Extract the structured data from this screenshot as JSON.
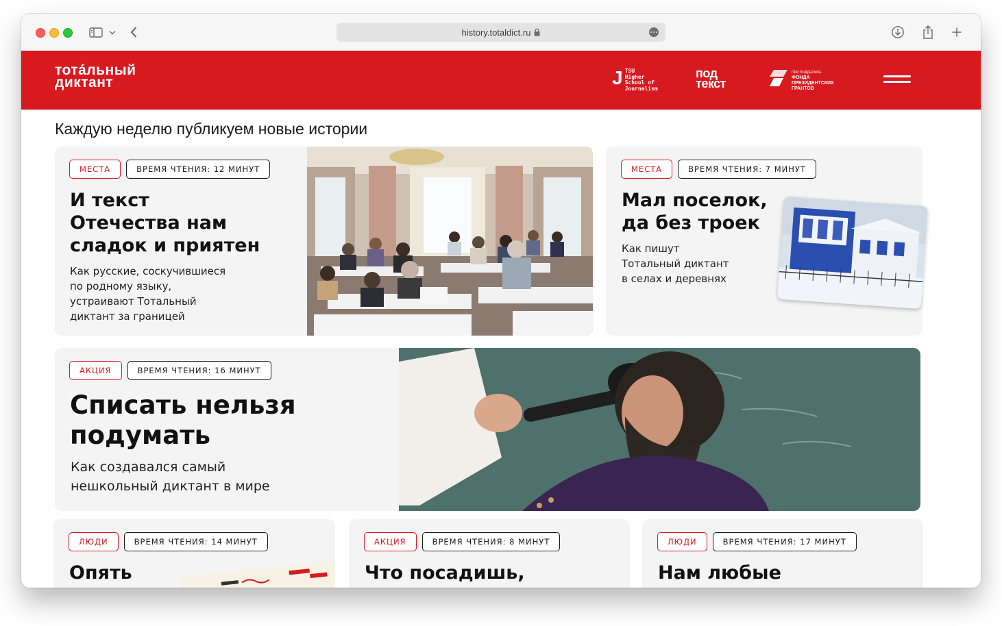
{
  "browser": {
    "url": "history.totaldict.ru"
  },
  "header": {
    "logo_line1": "тотáльный",
    "logo_line2": "диктант",
    "partners": {
      "tsu_line1": "TSU",
      "tsu_line2": "Higher",
      "tsu_line3": "School of",
      "tsu_line4": "Journalism",
      "podtekst_line1": "под",
      "podtekst_line2": "текст",
      "fond_line0": "ПРИ ПОДДЕРЖКЕ",
      "fond_line1": "ФОНДА",
      "fond_line2": "ПРЕЗИДЕНТСКИХ",
      "fond_line3": "ГРАНТОВ"
    }
  },
  "page": {
    "headline": "Каждую неделю публикуем новые истории"
  },
  "cards": [
    {
      "tag": "МЕСТА",
      "reading_time": "ВРЕМЯ ЧТЕНИЯ: 12 МИНУТ",
      "title_lines": [
        "И текст",
        "Отечества нам",
        "сладок и приятен"
      ],
      "desc_lines": [
        "Как русские, соскучившиеся",
        "по родному языку,",
        "устраивают Тотальный",
        "диктант за границей"
      ]
    },
    {
      "tag": "МЕСТА",
      "reading_time": "ВРЕМЯ ЧТЕНИЯ: 7 МИНУТ",
      "title_lines": [
        "Мал поселок,",
        "да без троек"
      ],
      "desc_lines": [
        "Как пишут",
        "Тотальный диктант",
        "в селах и деревнях"
      ]
    },
    {
      "tag": "АКЦИЯ",
      "reading_time": "ВРЕМЯ ЧТЕНИЯ: 16 МИНУТ",
      "title_lines": [
        "Списать нельзя",
        "подумать"
      ],
      "desc_lines": [
        "Как создавался самый",
        "нешкольный диктант в мире"
      ]
    },
    {
      "tag": "ЛЮДИ",
      "reading_time": "ВРЕМЯ ЧТЕНИЯ: 14 МИНУТ",
      "title_lines": [
        "Опять"
      ]
    },
    {
      "tag": "АКЦИЯ",
      "reading_time": "ВРЕМЯ ЧТЕНИЯ: 8 МИНУТ",
      "title_lines": [
        "Что посадишь,"
      ]
    },
    {
      "tag": "ЛЮДИ",
      "reading_time": "ВРЕМЯ ЧТЕНИЯ: 17 МИНУТ",
      "title_lines": [
        "Нам любые"
      ]
    }
  ],
  "colors": {
    "brand_red": "#d71920",
    "card_bg": "#f4f4f4"
  },
  "icons": [
    "sidebar-icon",
    "chevron-down-icon",
    "back-icon",
    "lock-icon",
    "more-icon",
    "download-icon",
    "share-icon",
    "plus-icon",
    "hamburger-menu-icon"
  ]
}
